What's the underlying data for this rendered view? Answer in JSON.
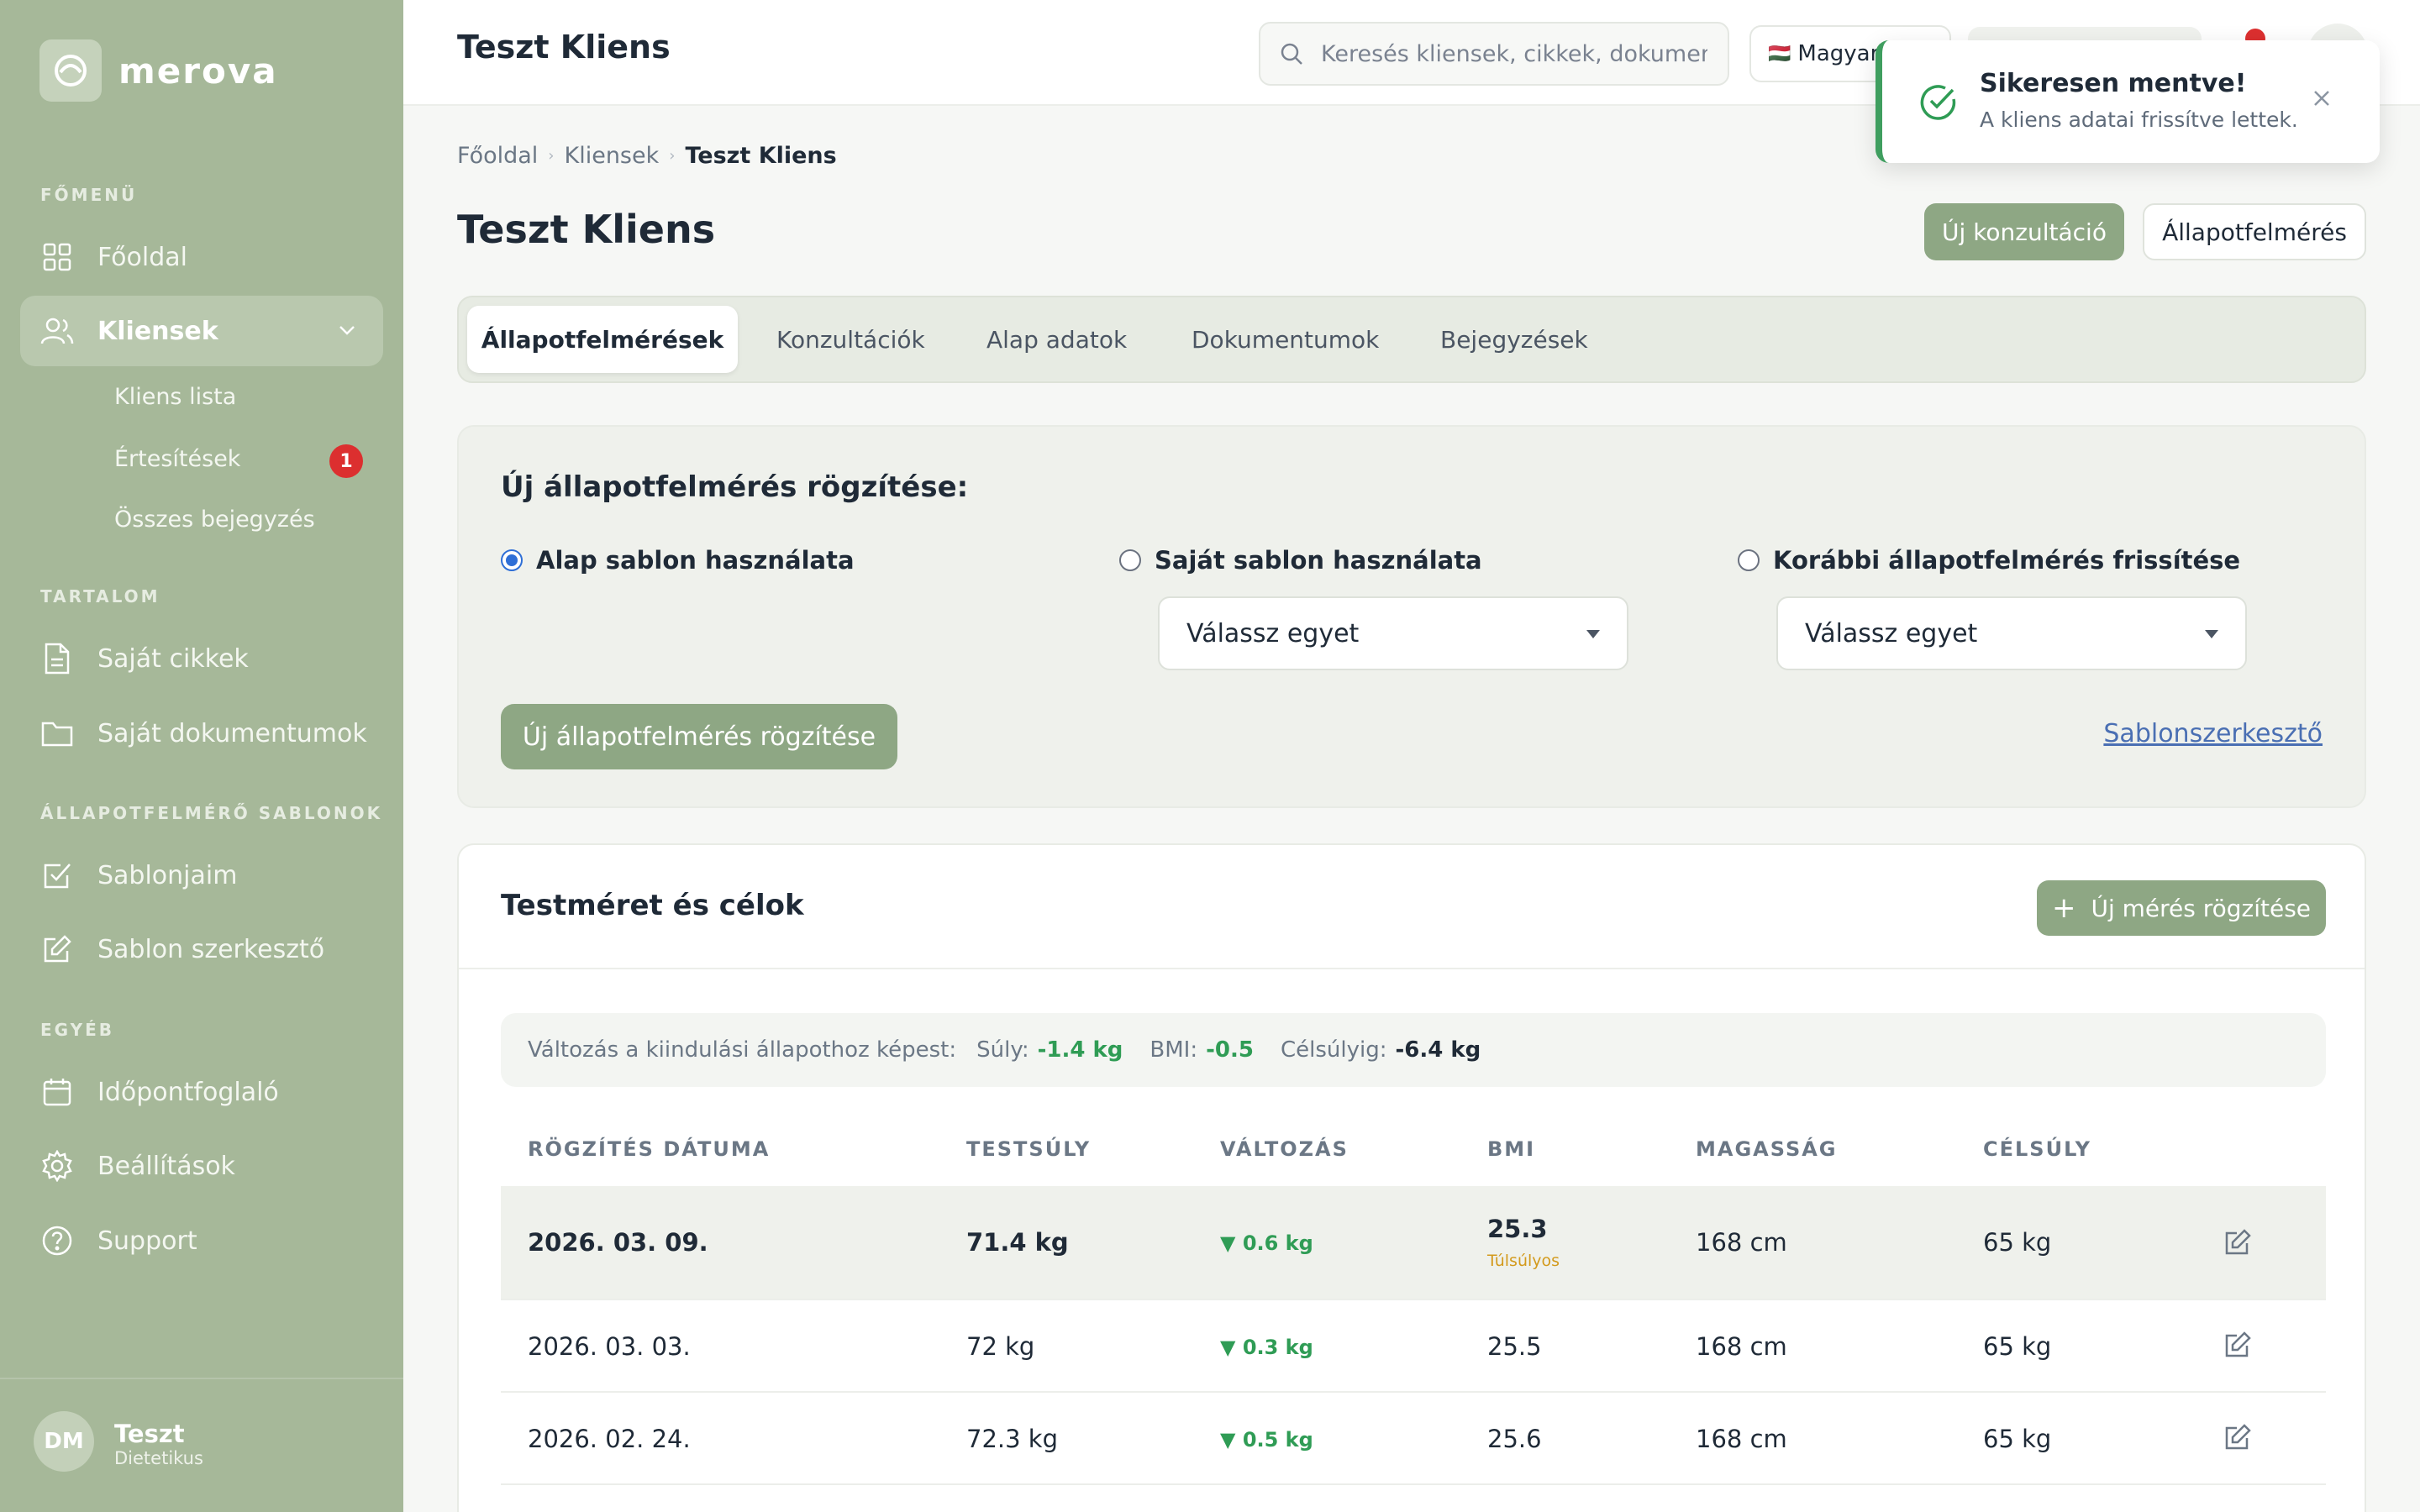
{
  "brand": {
    "name": "merova"
  },
  "sidebar": {
    "sections": {
      "main": "FŐMENÜ",
      "content": "TARTALOM",
      "templates": "ÁLLAPOTFELMÉRŐ SABLONOK",
      "other": "EGYÉB"
    },
    "items": {
      "home": "Főoldal",
      "clients": "Kliensek",
      "my_articles": "Saját cikkek",
      "my_documents": "Saját dokumentumok",
      "my_templates": "Sablonjaim",
      "template_editor": "Sablon szerkesztő",
      "booking": "Időpontfoglaló",
      "settings": "Beállítások",
      "support": "Support"
    },
    "sub_items": {
      "client_list": "Kliens lista",
      "notifications": "Értesítések",
      "all_entries": "Összes bejegyzés"
    },
    "notifications_count": "1",
    "user": {
      "initials": "DM",
      "name": "Teszt",
      "role": "Dietetikus"
    }
  },
  "topbar": {
    "title": "Teszt Kliens",
    "search_placeholder": "Keresés kliensek, cikkek, dokumentumok...",
    "language": "Magyar",
    "language_flag": "🇭🇺"
  },
  "toast": {
    "title": "Sikeresen mentve!",
    "message": "A kliens adatai frissítve lettek."
  },
  "breadcrumb": {
    "items": [
      "Főoldal",
      "Kliensek"
    ],
    "current": "Teszt Kliens"
  },
  "page": {
    "title": "Teszt Kliens",
    "btn_new_consultation": "Új konzultáció",
    "btn_assessment": "Állapotfelmérés"
  },
  "tabs": [
    "Állapotfelmérések",
    "Konzultációk",
    "Alap adatok",
    "Dokumentumok",
    "Bejegyzések"
  ],
  "new_assessment": {
    "heading": "Új állapotfelmérés rögzítése:",
    "option_default": "Alap sablon használata",
    "option_own": "Saját sablon használata",
    "option_previous": "Korábbi állapotfelmérés frissítése",
    "select_placeholder": "Válassz egyet",
    "submit": "Új állapotfelmérés rögzítése",
    "template_editor_link": "Sablonszerkesztő"
  },
  "measurements": {
    "title": "Testméret és célok",
    "add_button": "Új mérés rögzítése",
    "summary": {
      "label": "Változás a kiindulási állapothoz képest:",
      "weight_label": "Súly:",
      "weight": "-1.4 kg",
      "bmi_label": "BMI:",
      "bmi": "-0.5",
      "target_label": "Célsúlyig:",
      "target": "-6.4 kg"
    },
    "columns": [
      "RÖGZÍTÉS DÁTUMA",
      "TESTSÚLY",
      "VÁLTOZÁS",
      "BMI",
      "MAGASSÁG",
      "CÉLSÚLY"
    ],
    "rows": [
      {
        "date": "2026. 03. 09.",
        "weight": "71.4 kg",
        "change": "▼ 0.6 kg",
        "bmi": "25.3",
        "bmi_note": "Túlsúlyos",
        "height": "168 cm",
        "target": "65 kg"
      },
      {
        "date": "2026. 03. 03.",
        "weight": "72 kg",
        "change": "▼ 0.3 kg",
        "bmi": "25.5",
        "height": "168 cm",
        "target": "65 kg"
      },
      {
        "date": "2026. 02. 24.",
        "weight": "72.3 kg",
        "change": "▼ 0.5 kg",
        "bmi": "25.6",
        "height": "168 cm",
        "target": "65 kg"
      }
    ]
  },
  "colors": {
    "sidebar": "#a6b899",
    "accent": "#8ea784",
    "success": "#2f9c55",
    "danger": "#dc2f2f",
    "warning": "#d39a1c"
  }
}
